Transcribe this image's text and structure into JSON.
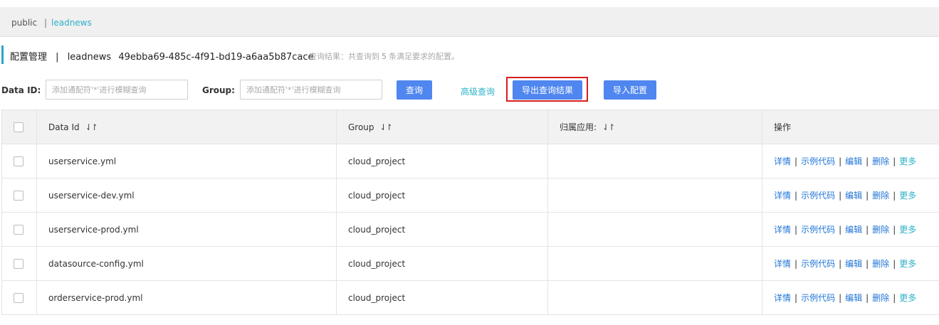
{
  "namespaces": {
    "public": "public",
    "separator": "|",
    "current": "leadnews"
  },
  "page_title": {
    "title": "配置管理",
    "separator": "|",
    "namespace_name": "leadnews",
    "namespace_id": "49ebba69-485c-4f91-bd19-a6aa5b87cace",
    "result_prefix": "查询结果：共查询到",
    "result_count": "5",
    "result_suffix": "条满足要求的配置。"
  },
  "filters": {
    "data_id_label": "Data ID:",
    "data_id_placeholder": "添加通配符'*'进行模糊查询",
    "group_label": "Group:",
    "group_placeholder": "添加通配符'*'进行模糊查询",
    "query_button": "查询",
    "advanced_query": "高级查询",
    "export_button": "导出查询结果",
    "import_button": "导入配置"
  },
  "table": {
    "columns": {
      "data_id": "Data Id",
      "group": "Group",
      "app": "归属应用:",
      "actions": "操作"
    },
    "sort_icon": "⇃↾",
    "actions": {
      "detail": "详情",
      "sample_code": "示例代码",
      "edit": "编辑",
      "delete": "删除",
      "more": "更多",
      "sep": "|"
    },
    "rows": [
      {
        "data_id": "userservice.yml",
        "group": "cloud_project",
        "app": ""
      },
      {
        "data_id": "userservice-dev.yml",
        "group": "cloud_project",
        "app": ""
      },
      {
        "data_id": "userservice-prod.yml",
        "group": "cloud_project",
        "app": ""
      },
      {
        "data_id": "datasource-config.yml",
        "group": "cloud_project",
        "app": ""
      },
      {
        "data_id": "orderservice-prod.yml",
        "group": "cloud_project",
        "app": ""
      }
    ]
  },
  "colors": {
    "primary_button": "#4f86f0",
    "link": "#1f74d6",
    "accent_link": "#2bb1c8",
    "highlight_outline": "#d71e1e"
  }
}
